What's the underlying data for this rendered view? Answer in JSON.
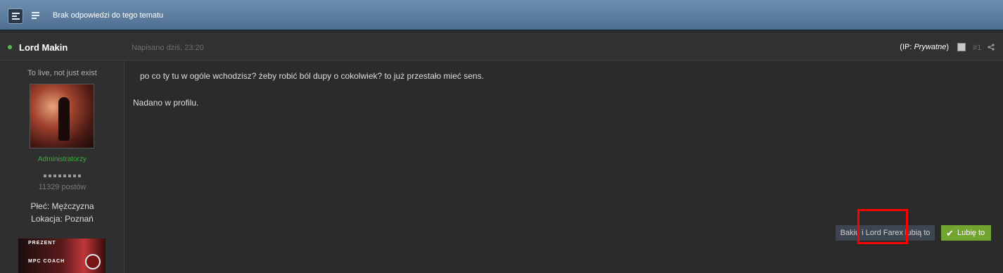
{
  "topbar": {
    "title": "Brak odpowiedzi do tego tematu",
    "view_toggle_icon": "full-view-icon",
    "list_icon": "list-view-icon"
  },
  "post": {
    "author": "Lord Makin",
    "date": "Napisano dziś, 23:20",
    "ip_prefix": "(IP: ",
    "ip_value": "Prywatne",
    "ip_suffix": ")",
    "post_number": "#1",
    "share_icon": "share-icon",
    "content_line1": "po co ty tu w ogóle wchodzisz? żeby robić ból dupy o cokolwiek? to już przestało mieć sens.",
    "content_line2": "Nadano w profilu.",
    "likes_text": "Bakiu i Lord Farex lubią to",
    "like_button": "Lubię to"
  },
  "author_panel": {
    "tagline": "To live, not just exist",
    "group": "Administratorzy",
    "post_count": "11329 postów",
    "gender": "Płeć: Mężczyzna",
    "location": "Lokacja: Poznań",
    "badge_line1": "PREZENT",
    "badge_line2": "MPC COACH"
  },
  "colors": {
    "online": "#59b85a",
    "group": "#3fae3f",
    "like_button": "#72a52f",
    "highlight": "#ff0000"
  }
}
